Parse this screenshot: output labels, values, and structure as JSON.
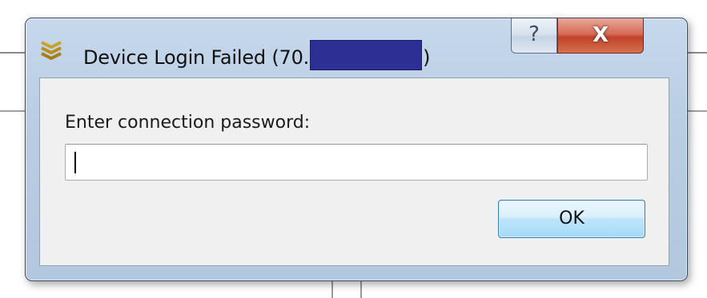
{
  "window": {
    "title_prefix": "Device Login Failed (70.",
    "title_suffix": ")",
    "app_icon": "chevron-stack-icon",
    "help_glyph": "?",
    "close_glyph": "X"
  },
  "dialog": {
    "prompt": "Enter connection password:",
    "password_value": "",
    "ok_label": "OK"
  },
  "colors": {
    "redaction": "#2e2f94",
    "close_button": "#c0432a",
    "icon_gold": "#c9a227"
  }
}
